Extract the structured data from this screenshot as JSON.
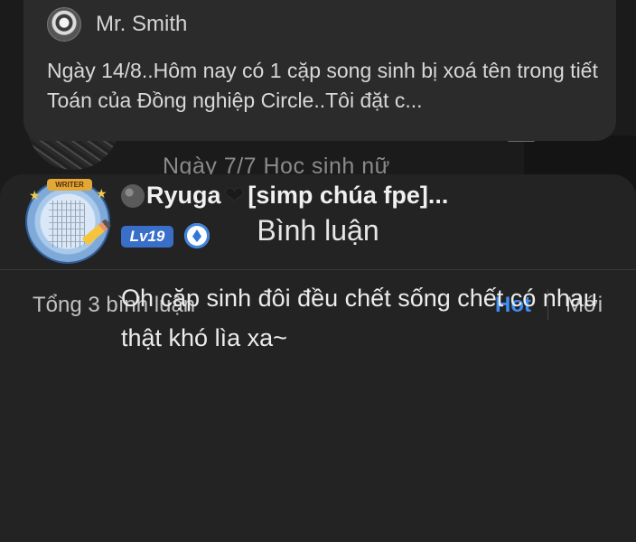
{
  "popup": {
    "author": "Mr. Smith",
    "text": "Ngày 14/8..Hôm nay có 1 cặp song sinh bị xoá tên trong tiết Toán của Đồng nghiệp Circle..Tôi đặt c..."
  },
  "background": {
    "snippet": "Ngày 7/7 Học sinh nữ"
  },
  "sheet": {
    "title": "Bình luận",
    "count": "Tổng 3 bình luận",
    "sort_hot": "Hot",
    "sort_new": "Mới"
  },
  "comment": {
    "author": "Ryuga",
    "author_suffix": "[simp chúa fpe]...",
    "level": "Lv19",
    "avatar_banner": "WRITER",
    "text": "Oh cặp sinh đôi đều chết sống chết có nhau thật khó lìa xa~"
  },
  "colors": {
    "accent": "#3f8ef2",
    "level_badge": "#3a6fc9",
    "sheet_bg": "#232323",
    "popup_bg": "#2b2b2b"
  }
}
